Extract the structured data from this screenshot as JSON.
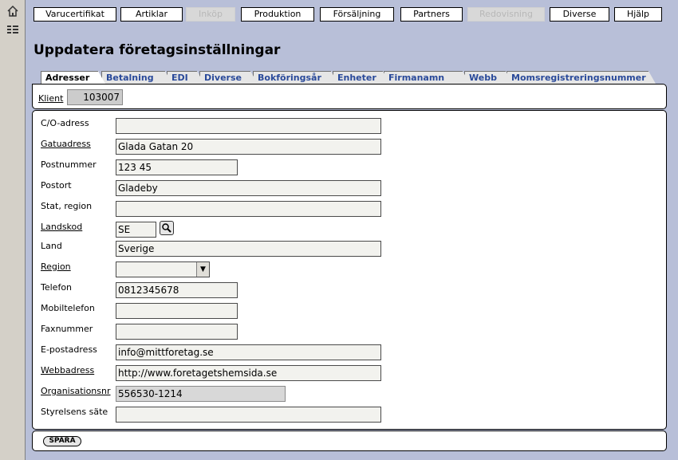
{
  "nav": {
    "items": [
      {
        "label": "Varucertifikat",
        "enabled": true
      },
      {
        "label": "Artiklar",
        "enabled": true
      },
      {
        "label": "Inköp",
        "enabled": false
      },
      {
        "label": "Produktion",
        "enabled": true
      },
      {
        "label": "Försäljning",
        "enabled": true
      },
      {
        "label": "Partners",
        "enabled": true
      },
      {
        "label": "Redovisning",
        "enabled": false
      },
      {
        "label": "Diverse",
        "enabled": true
      },
      {
        "label": "Hjälp",
        "enabled": true
      }
    ]
  },
  "sidebar": {
    "icons": [
      "home-icon",
      "list-icon"
    ]
  },
  "page": {
    "title": "Uppdatera företagsinställningar"
  },
  "tabs": [
    {
      "label": "Adresser",
      "active": true
    },
    {
      "label": "Betalning",
      "active": false
    },
    {
      "label": "EDI",
      "active": false
    },
    {
      "label": "Diverse",
      "active": false
    },
    {
      "label": "Bokföringsår",
      "active": false
    },
    {
      "label": "Enheter",
      "active": false
    },
    {
      "label": "Firmanamn",
      "active": false
    },
    {
      "label": "Webb",
      "active": false
    },
    {
      "label": "Momsregistreringsnummer",
      "active": false
    }
  ],
  "client": {
    "label": "Klient",
    "value": "103007"
  },
  "form": {
    "co_address": {
      "label": "C/O-adress",
      "value": ""
    },
    "street_address": {
      "label": "Gatuadress",
      "value": "Glada Gatan 20"
    },
    "postal_code": {
      "label": "Postnummer",
      "value": "123 45"
    },
    "city": {
      "label": "Postort",
      "value": "Gladeby"
    },
    "state_region": {
      "label": "Stat, region",
      "value": ""
    },
    "country_code": {
      "label": "Landskod",
      "value": "SE"
    },
    "country": {
      "label": "Land",
      "value": "Sverige"
    },
    "region": {
      "label": "Region",
      "value": ""
    },
    "phone": {
      "label": "Telefon",
      "value": "0812345678"
    },
    "mobile": {
      "label": "Mobiltelefon",
      "value": ""
    },
    "fax": {
      "label": "Faxnummer",
      "value": ""
    },
    "email": {
      "label": "E-postadress",
      "value": "info@mittforetag.se"
    },
    "website": {
      "label": "Webbadress",
      "value": "http://www.foretagetshemsida.se"
    },
    "org_number": {
      "label": "Organisationsnr",
      "value": "556530-1214"
    },
    "board_seat": {
      "label": "Styrelsens säte",
      "value": ""
    }
  },
  "footer": {
    "save_label": "SPARA"
  }
}
